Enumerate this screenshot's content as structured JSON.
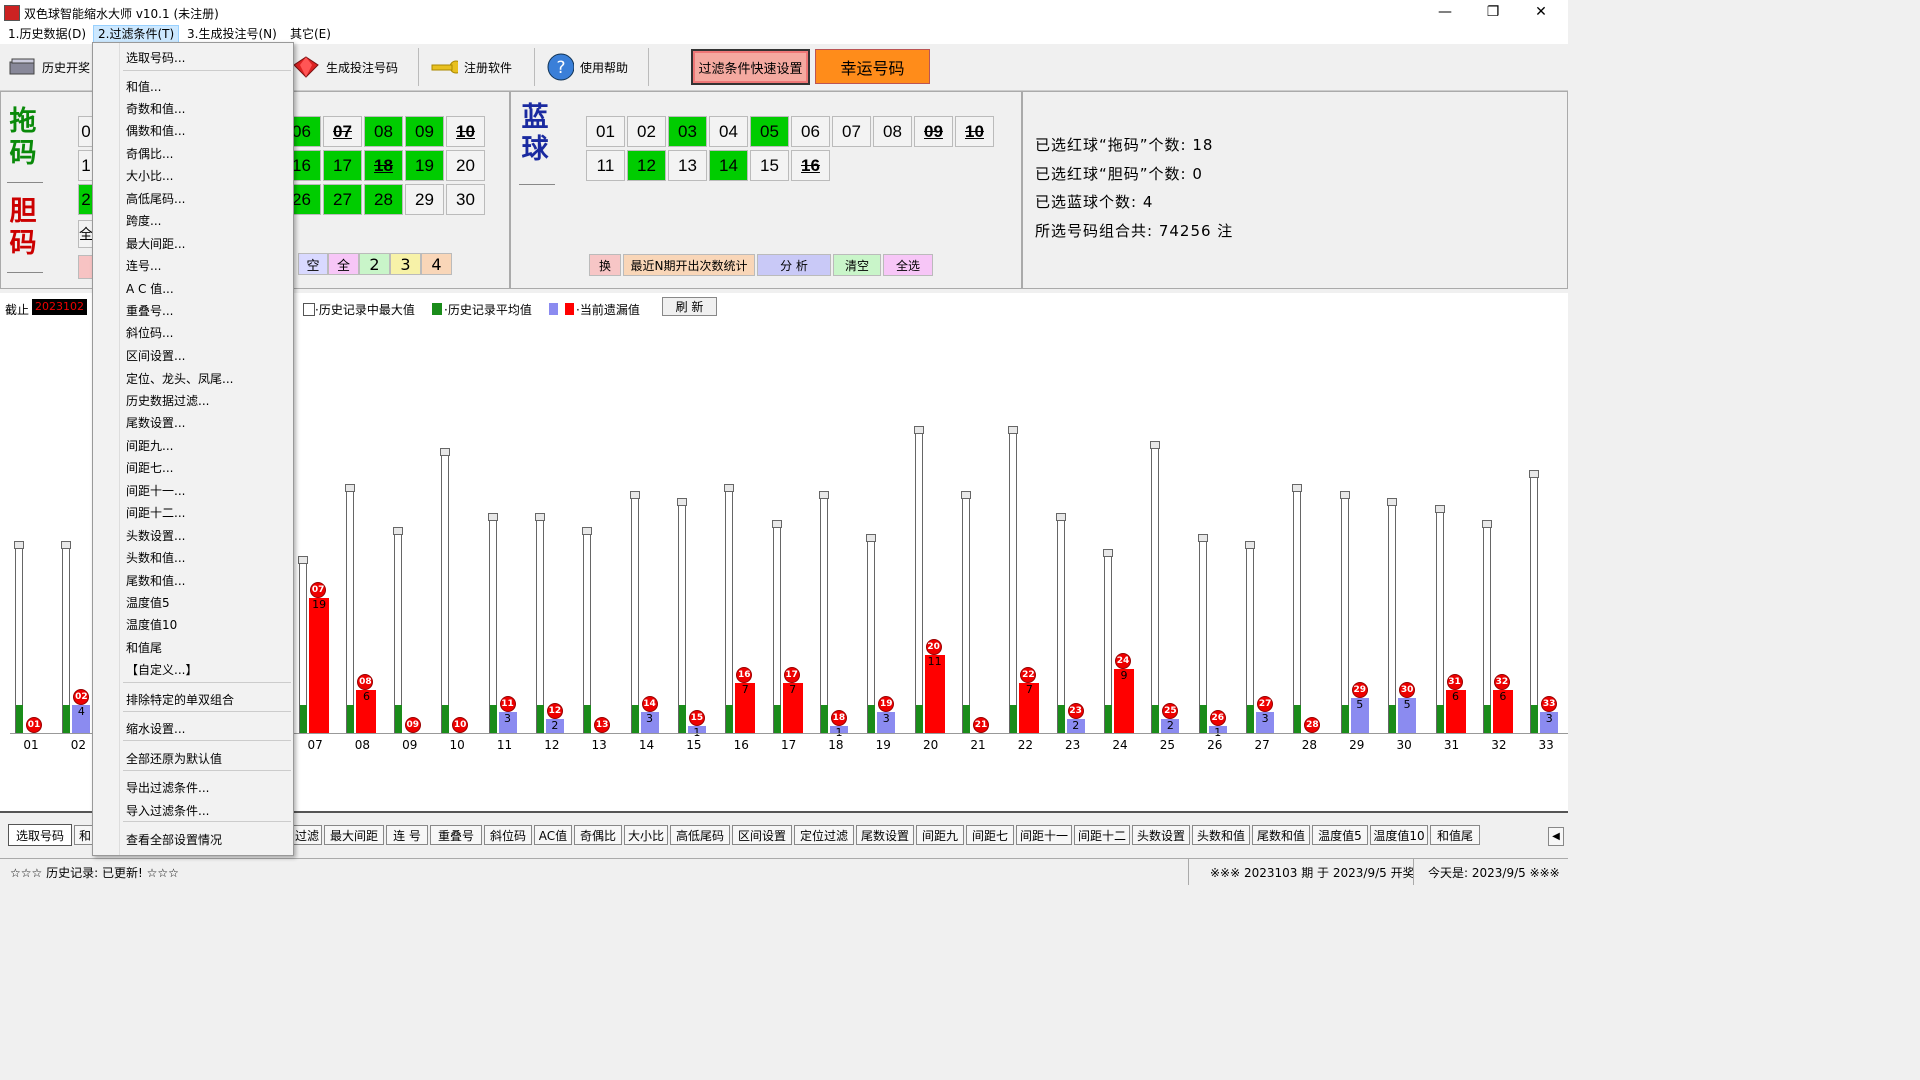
{
  "window": {
    "title": "双色球智能缩水大师 v10.1  (未注册)",
    "minimize": "—",
    "restore": "❐",
    "close": "✕"
  },
  "menu": [
    "1.历史数据(D)",
    "2.过滤条件(T)",
    "3.生成投注号(N)",
    "其它(E)"
  ],
  "toolbar": {
    "history": "历史开奖",
    "generate": "生成投注号码",
    "register": "注册软件",
    "help": "使用帮助",
    "quick_filter": "过滤条件快速设置",
    "lucky": "幸运号码"
  },
  "red_panel": {
    "tuo_label_1": "拖",
    "tuo_label_2": "码",
    "dan_label_1": "胆",
    "dan_label_2": "码",
    "rows": [
      [
        {
          "n": "06",
          "s": "g"
        },
        {
          "n": "07",
          "s": "x"
        },
        {
          "n": "08",
          "s": "g"
        },
        {
          "n": "09",
          "s": "g"
        },
        {
          "n": "10",
          "s": "x"
        }
      ],
      [
        {
          "n": "16",
          "s": "g"
        },
        {
          "n": "17",
          "s": "g"
        },
        {
          "n": "18",
          "s": "gx"
        },
        {
          "n": "19",
          "s": "g"
        },
        {
          "n": "20",
          "s": ""
        }
      ],
      [
        {
          "n": "26",
          "s": "g"
        },
        {
          "n": "27",
          "s": "g"
        },
        {
          "n": "28",
          "s": "g"
        },
        {
          "n": "29",
          "s": ""
        },
        {
          "n": "30",
          "s": ""
        }
      ]
    ],
    "buttons": [
      "空",
      "全",
      "2",
      "3",
      "4"
    ]
  },
  "blue_panel": {
    "label_1": "蓝",
    "label_2": "球",
    "rows": [
      [
        {
          "n": "01",
          "s": ""
        },
        {
          "n": "02",
          "s": ""
        },
        {
          "n": "03",
          "s": "g"
        },
        {
          "n": "04",
          "s": ""
        },
        {
          "n": "05",
          "s": "g"
        },
        {
          "n": "06",
          "s": ""
        },
        {
          "n": "07",
          "s": ""
        },
        {
          "n": "08",
          "s": ""
        },
        {
          "n": "09",
          "s": "x"
        },
        {
          "n": "10",
          "s": "x"
        }
      ],
      [
        {
          "n": "11",
          "s": ""
        },
        {
          "n": "12",
          "s": "g"
        },
        {
          "n": "13",
          "s": ""
        },
        {
          "n": "14",
          "s": "g"
        },
        {
          "n": "15",
          "s": ""
        },
        {
          "n": "16",
          "s": "x"
        }
      ]
    ],
    "buttons": [
      "换",
      "最近N期开出次数统计",
      "分 析",
      "清空",
      "全选"
    ]
  },
  "stats": {
    "tuo": "已选红球“拖码”个数:  18",
    "dan": "已选红球“胆码”个数:  0",
    "blue": "已选蓝球个数:  4",
    "total": "所选号码组合共:  74256  注"
  },
  "chart_header": {
    "cutoff_label": "截止",
    "cutoff_value": "2023102",
    "legend_max": "·历史记录中最大值",
    "legend_avg": "·历史记录平均值",
    "legend_cur": "·当前遗漏值",
    "refresh": "刷 新"
  },
  "chart_data": {
    "type": "bar",
    "categories": [
      "01",
      "02",
      "03",
      "04",
      "05",
      "06",
      "07",
      "08",
      "09",
      "10",
      "11",
      "12",
      "13",
      "14",
      "15",
      "16",
      "17",
      "18",
      "19",
      "20",
      "21",
      "22",
      "23",
      "24",
      "25",
      "26",
      "27",
      "28",
      "29",
      "30",
      "31",
      "32",
      "33"
    ],
    "series": [
      {
        "name": "历史记录中最大值",
        "values": [
          26,
          26,
          null,
          null,
          null,
          null,
          24,
          34,
          28,
          39,
          30,
          30,
          28,
          33,
          32,
          34,
          29,
          33,
          27,
          42,
          33,
          42,
          30,
          25,
          40,
          27,
          26,
          34,
          33,
          32,
          31,
          29,
          36
        ]
      },
      {
        "name": "历史记录平均值",
        "values": [
          6,
          6,
          null,
          null,
          null,
          null,
          6,
          6,
          6,
          6,
          6,
          6,
          6,
          6,
          6,
          6,
          6,
          6,
          6,
          6,
          6,
          6,
          6,
          6,
          6,
          6,
          6,
          6,
          6,
          6,
          6,
          6,
          6
        ]
      },
      {
        "name": "当前遗漏值",
        "values": [
          0,
          4,
          null,
          null,
          null,
          null,
          19,
          6,
          0,
          0,
          3,
          2,
          0,
          3,
          1,
          7,
          7,
          1,
          3,
          11,
          0,
          7,
          2,
          9,
          2,
          1,
          3,
          0,
          5,
          5,
          6,
          6,
          3
        ],
        "colors": [
          "red",
          "blue",
          null,
          null,
          null,
          null,
          "red",
          "red",
          "red",
          "red",
          "blue",
          "blue",
          "red",
          "blue",
          "blue",
          "red",
          "red",
          "blue",
          "blue",
          "red",
          "red",
          "red",
          "blue",
          "red",
          "blue",
          "blue",
          "blue",
          "red",
          "blue",
          "blue",
          "red",
          "red",
          "blue"
        ]
      }
    ],
    "title": "",
    "xlabel": "",
    "ylabel": ""
  },
  "dropdown": [
    "选取号码...",
    "和值...",
    "奇数和值...",
    "偶数和值...",
    "奇偶比...",
    "大小比...",
    "高低尾码...",
    "跨度...",
    "最大间距...",
    "连号...",
    "A C 值...",
    "重叠号...",
    "斜位码...",
    "区间设置...",
    "定位、龙头、凤尾...",
    "历史数据过滤...",
    "尾数设置...",
    "间距九...",
    "间距七...",
    "间距十一...",
    "间距十二...",
    "头数设置...",
    "头数和值...",
    "尾数和值...",
    "温度值5",
    "温度值10",
    "和值尾",
    "【自定义...】",
    "排除特定的单双组合",
    "缩水设置...",
    "全部还原为默认值",
    "导出过滤条件...",
    "导入过滤条件...",
    "查看全部设置情况"
  ],
  "tabs": [
    "选取号码",
    "和",
    "过滤",
    "最大间距",
    "连 号",
    "重叠号",
    "斜位码",
    "AC值",
    "奇偶比",
    "大小比",
    "高低尾码",
    "区间设置",
    "定位过滤",
    "尾数设置",
    "间距九",
    "间距七",
    "间距十一",
    "间距十二",
    "头数设置",
    "头数和值",
    "尾数和值",
    "温度值5",
    "温度值10",
    "和值尾"
  ],
  "status": {
    "left": "☆☆☆  历史记录:  已更新!  ☆☆☆",
    "right1": "※※※  2023103 期 于 2023/9/5 开奖",
    "right2": "今天是:  2023/9/5  ※※※"
  }
}
